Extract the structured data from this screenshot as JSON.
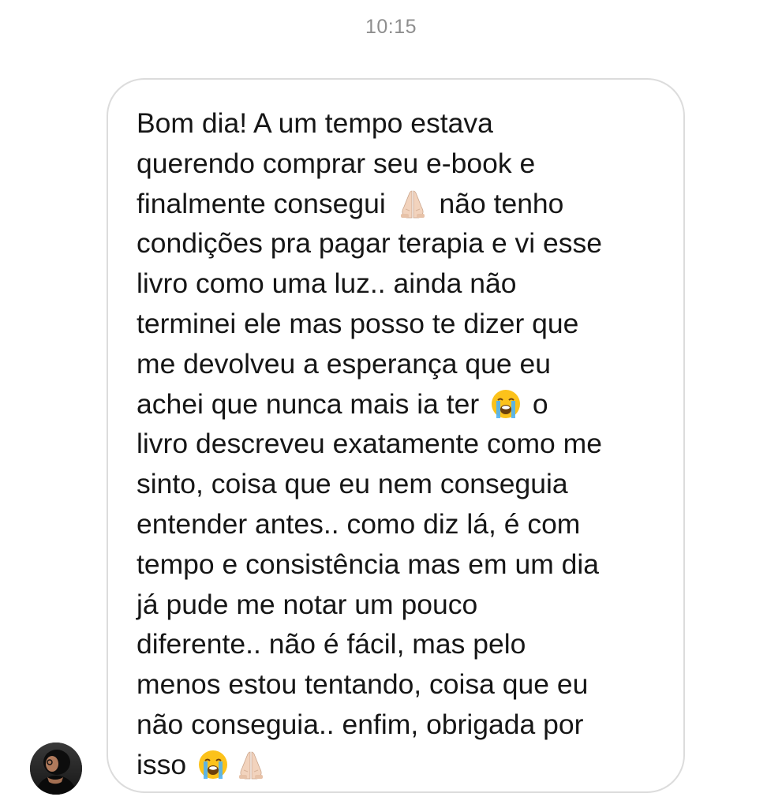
{
  "chat": {
    "timestamp": "10:15",
    "message": {
      "lines": [
        {
          "before": "Bom dia! A um tempo estava"
        },
        {
          "before": "querendo comprar seu e-book e"
        },
        {
          "before": "finalmente consegui ",
          "after": " não tenho",
          "emojis": [
            "folded-hands"
          ]
        },
        {
          "before": "condições pra pagar terapia e vi esse"
        },
        {
          "before": "livro como uma luz.. ainda não"
        },
        {
          "before": "terminei ele mas posso te dizer que"
        },
        {
          "before": "me devolveu a esperança que eu"
        },
        {
          "before": "achei que nunca mais ia ter ",
          "after": " o",
          "emojis": [
            "crying-face"
          ]
        },
        {
          "before": "livro descreveu exatamente como me"
        },
        {
          "before": "sinto, coisa que eu nem conseguia"
        },
        {
          "before": "entender antes.. como diz lá, é com"
        },
        {
          "before": "tempo e consistência mas em um dia"
        },
        {
          "before": "já pude me notar um pouco"
        },
        {
          "before": "diferente.. não é fácil, mas pelo"
        },
        {
          "before": "menos estou tentando, coisa que eu"
        },
        {
          "before": "não conseguia.. enfim, obrigada por"
        },
        {
          "before": "isso ",
          "after": "",
          "emojis": [
            "crying-face",
            "folded-hands"
          ]
        }
      ]
    },
    "sender": {
      "avatar_icon": "user-avatar-photo"
    }
  },
  "colors": {
    "timestamp": "#8e8e8e",
    "text": "#161616",
    "bubble_border": "#dcdcdc",
    "background": "#ffffff"
  }
}
